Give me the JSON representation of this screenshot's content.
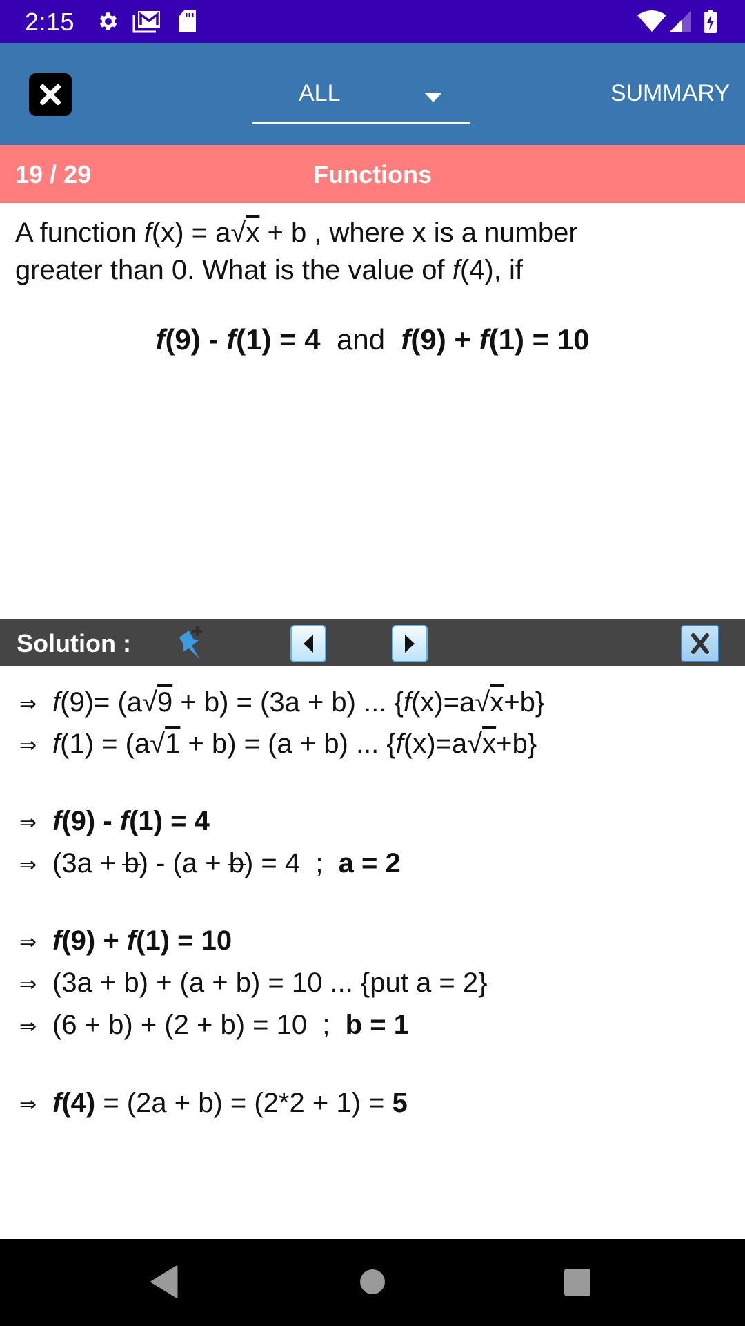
{
  "status_bar": {
    "time": "2:15",
    "icons": [
      "settings-gear-icon",
      "gmail-icon",
      "sd-card-icon",
      "wifi-icon",
      "cell-signal-icon",
      "battery-charging-icon"
    ]
  },
  "toolbar": {
    "close_icon": "close-x-icon",
    "filter": {
      "selected": "ALL"
    },
    "summary_label": "SUMMARY"
  },
  "category_bar": {
    "counter": "19 / 29",
    "topic": "Functions",
    "color": "#ff7d7d"
  },
  "question": {
    "line1_pre": "A function ",
    "fx": "f",
    "line1_x": "(x) = a√",
    "line1_rad": "x",
    "line1_post": " + b , where x is a number",
    "line2_pre": "greater than 0. What is the value of ",
    "line2_f": "f",
    "line2_post": "(4), if",
    "cond1_f1": "f",
    "cond1_a": "(9) - ",
    "cond1_f2": "f",
    "cond1_b": "(1) = 4",
    "cond_and": "and",
    "cond2_f1": "f",
    "cond2_a": "(9) + ",
    "cond2_f2": "f",
    "cond2_b": "(1) = 10"
  },
  "solution_bar": {
    "label": "Solution :",
    "pin_icon": "pin-add-icon",
    "prev_icon": "prev-arrow-icon",
    "next_icon": "next-arrow-icon",
    "close_label": "X"
  },
  "solution": {
    "arrow": "⇒",
    "s1": {
      "f": "f",
      "a": "(9)= (a√",
      "rad": "9",
      "b": " + b) = (3a + b) ... {",
      "f2": "f",
      "c": "(x)=a√",
      "rad2": "x",
      "d": "+b}"
    },
    "s2": {
      "f": "f",
      "a": "(1) = (a√",
      "rad": "1",
      "b": " + b) = (a + b) ... {",
      "f2": "f",
      "c": "(x)=a√",
      "rad2": "x",
      "d": "+b}"
    },
    "s3": {
      "f1": "f",
      "a": "(9) - ",
      "f2": "f",
      "b": "(1) = 4"
    },
    "s4": {
      "a": "(3a + ",
      "b1": "b",
      "c": ") - (a + ",
      "b2": "b",
      "d": ") = 4  ;  ",
      "result": "a = 2"
    },
    "s5": {
      "f1": "f",
      "a": "(9) + ",
      "f2": "f",
      "b": "(1) = 10"
    },
    "s6": {
      "text": "(3a + b) + (a + b) = 10 ... {put a = 2}"
    },
    "s7": {
      "text": "(6 + b) + (2 + b) = 10  ;  ",
      "result": "b = 1"
    },
    "s8": {
      "f": "f",
      "fb": "(4)",
      "text": " = (2a + b) = (2*2 + 1) = ",
      "result": "5"
    }
  },
  "nav_bar": {
    "back_icon": "back-triangle-icon",
    "home_icon": "home-circle-icon",
    "recents_icon": "recents-square-icon"
  }
}
